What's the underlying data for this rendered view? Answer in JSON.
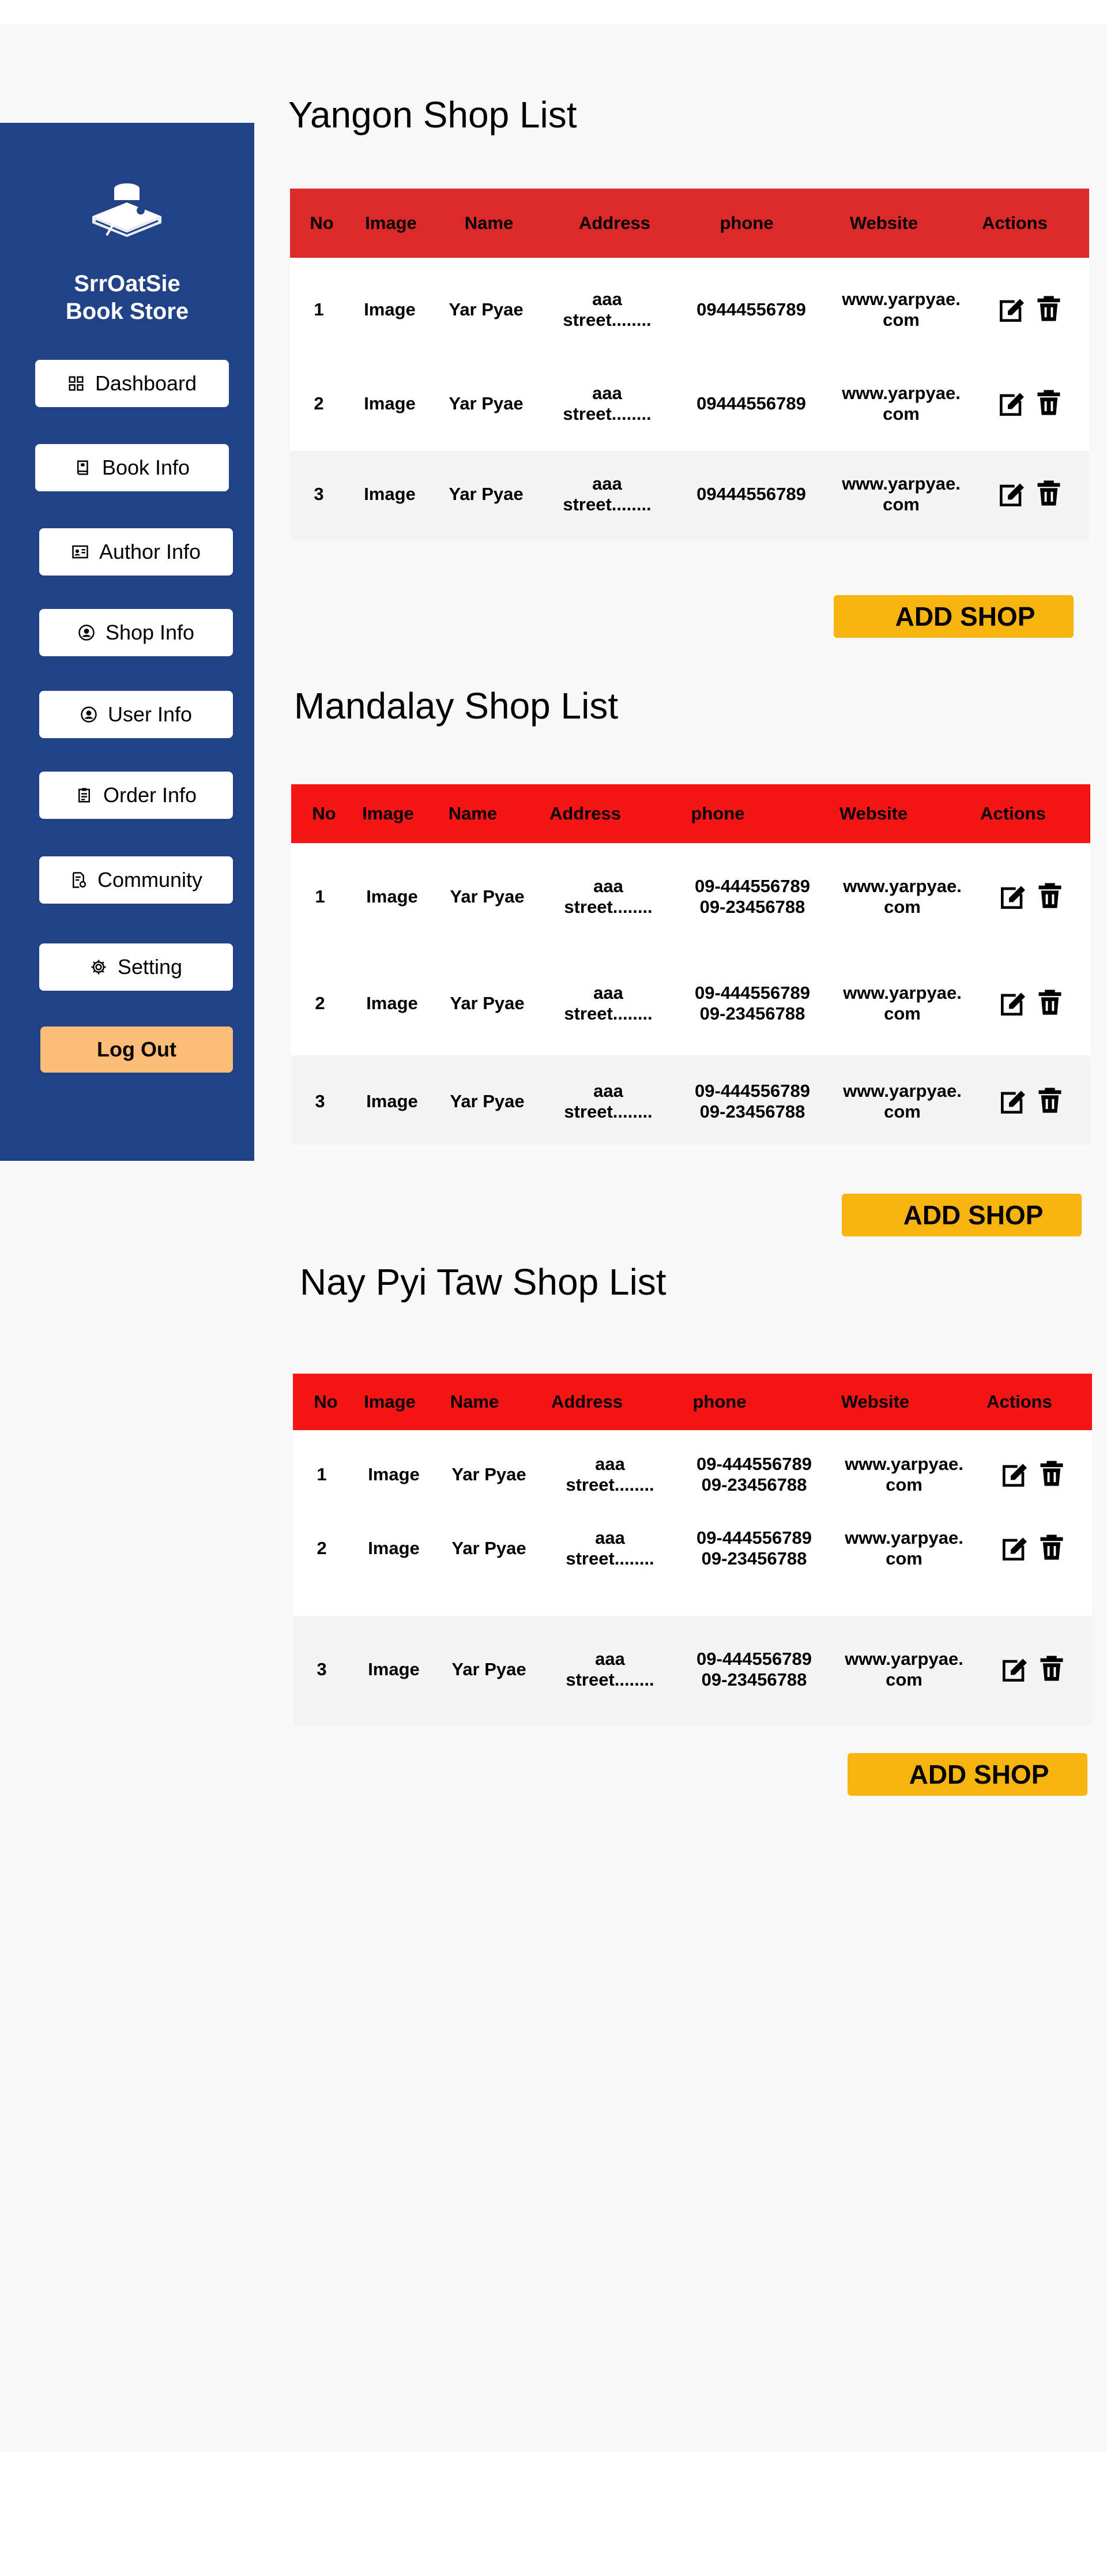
{
  "brand": {
    "line1": "SrrOatSie",
    "line2": "Book Store"
  },
  "nav": {
    "dashboard": "Dashboard",
    "book_info": "Book Info",
    "author_info": "Author Info",
    "shop_info": "Shop Info",
    "user_info": "User Info",
    "order_info": "Order Info",
    "community": "Community",
    "setting": "Setting",
    "logout": "Log Out"
  },
  "colors": {
    "sidebar": "#224287",
    "header_red_1": "#dc2a2a",
    "header_red_2": "#f51515",
    "add_button": "#f8b40e",
    "logout_button": "#fbbd76"
  },
  "headers": [
    "No",
    "Image",
    "Name",
    "Address",
    "phone",
    "Website",
    "Actions"
  ],
  "yangon": {
    "title": "Yangon Shop List",
    "add_label": "ADD SHOP",
    "rows": [
      {
        "no": "1",
        "image": "Image",
        "name": "Yar Pyae",
        "addr1": "aaa",
        "addr2": "street........",
        "phone1": "09444556789",
        "phone2": "",
        "web1": "www.yarpyae.",
        "web2": "com"
      },
      {
        "no": "2",
        "image": "Image",
        "name": "Yar Pyae",
        "addr1": "aaa",
        "addr2": "street........",
        "phone1": "09444556789",
        "phone2": "",
        "web1": "www.yarpyae.",
        "web2": "com"
      },
      {
        "no": "3",
        "image": "Image",
        "name": "Yar Pyae",
        "addr1": "aaa",
        "addr2": "street........",
        "phone1": "09444556789",
        "phone2": "",
        "web1": "www.yarpyae.",
        "web2": "com"
      }
    ]
  },
  "mandalay": {
    "title": "Mandalay Shop List",
    "add_label": "ADD SHOP",
    "rows": [
      {
        "no": "1",
        "image": "Image",
        "name": "Yar Pyae",
        "addr1": "aaa",
        "addr2": "street........",
        "phone1": "09-444556789",
        "phone2": "09-23456788",
        "web1": "www.yarpyae.",
        "web2": "com"
      },
      {
        "no": "2",
        "image": "Image",
        "name": "Yar Pyae",
        "addr1": "aaa",
        "addr2": "street........",
        "phone1": "09-444556789",
        "phone2": "09-23456788",
        "web1": "www.yarpyae.",
        "web2": "com"
      },
      {
        "no": "3",
        "image": "Image",
        "name": "Yar Pyae",
        "addr1": "aaa",
        "addr2": "street........",
        "phone1": "09-444556789",
        "phone2": "09-23456788",
        "web1": "www.yarpyae.",
        "web2": "com"
      }
    ]
  },
  "naypyitaw": {
    "title": "Nay Pyi Taw Shop List",
    "add_label": "ADD SHOP",
    "rows": [
      {
        "no": "1",
        "image": "Image",
        "name": "Yar Pyae",
        "addr1": "aaa",
        "addr2": "street........",
        "phone1": "09-444556789",
        "phone2": "09-23456788",
        "web1": "www.yarpyae.",
        "web2": "com"
      },
      {
        "no": "2",
        "image": "Image",
        "name": "Yar Pyae",
        "addr1": "aaa",
        "addr2": "street........",
        "phone1": "09-444556789",
        "phone2": "09-23456788",
        "web1": "www.yarpyae.",
        "web2": "com"
      },
      {
        "no": "3",
        "image": "Image",
        "name": "Yar Pyae",
        "addr1": "aaa",
        "addr2": "street........",
        "phone1": "09-444556789",
        "phone2": "09-23456788",
        "web1": "www.yarpyae.",
        "web2": "com"
      }
    ]
  },
  "icons": {
    "edit": "edit-icon",
    "delete": "trash-icon"
  }
}
